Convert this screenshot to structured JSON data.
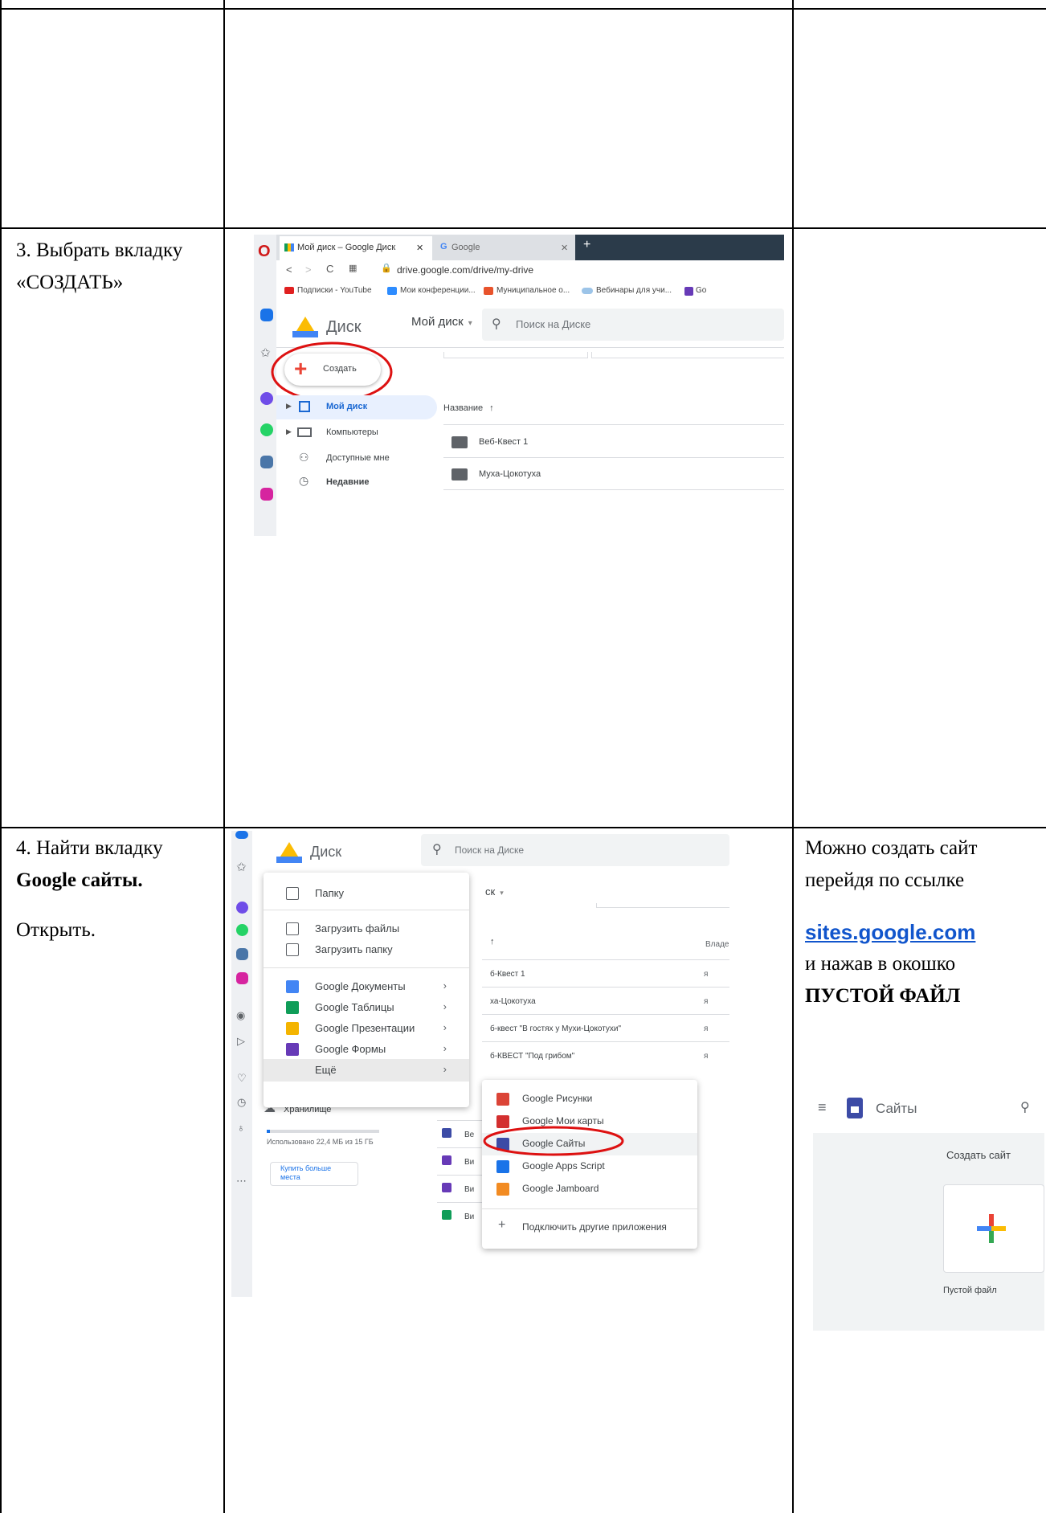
{
  "rows": [
    {
      "step": "3. Выбрать вкладку «СОЗДАТЬ»"
    },
    {
      "step_line1": "4. Найти вкладку",
      "step_bold": "Google сайты.",
      "step_line3": "Открыть."
    }
  ],
  "note": {
    "line1": "Можно создать сайт",
    "line2": "перейдя по ссылке",
    "link": "sites.google.com",
    "line3": "и нажав в окошко",
    "bold": "ПУСТОЙ ФАЙЛ"
  },
  "shot1": {
    "tab_active": "Мой диск – Google Диск",
    "tab_close": "✕",
    "tab_inactive": "Google",
    "url": "drive.google.com/drive/my-drive",
    "bookmarks": [
      "Подписки - YouTube",
      "Мои конференции...",
      "Муниципальное о...",
      "Вебинары для учи...",
      "Go"
    ],
    "app_name": "Диск",
    "search_placeholder": "Поиск на Диске",
    "create_label": "Создать",
    "my_drive_title": "Мой диск",
    "nav": [
      "Мой диск",
      "Компьютеры",
      "Доступные мне",
      "Недавние"
    ],
    "column_name": "Название",
    "files": [
      "Веб-Квест 1",
      "Муха-Цокотуха"
    ]
  },
  "shot2": {
    "app_name": "Диск",
    "search_placeholder": "Поиск на Диске",
    "header_fragment": "ск",
    "owner_col": "Владе",
    "menu": [
      "Папку",
      "Загрузить файлы",
      "Загрузить папку",
      "Google Документы",
      "Google Таблицы",
      "Google Презентации",
      "Google Формы",
      "Ещё"
    ],
    "files": [
      "б-Квест 1",
      "ха-Цокотуха",
      "б-квест \"В гостях у Мухи-Цокотухи\"",
      "б-КВЕСТ \"Под грибом\""
    ],
    "owner": "я",
    "storage_label": "Хранилище",
    "storage_used": "Использовано 22,4 МБ из 15 ГБ",
    "buy_more": "Купить больше места",
    "submenu": [
      "Google Рисунки",
      "Google Мои карты",
      "Google Сайты",
      "Google Apps Script",
      "Google Jamboard",
      "Подключить другие приложения"
    ],
    "row_frags": [
      "Ве",
      "Ви",
      "Ви",
      "Ви"
    ]
  },
  "shot3": {
    "title": "Сайты",
    "create_site": "Создать сайт",
    "blank": "Пустой файл"
  }
}
